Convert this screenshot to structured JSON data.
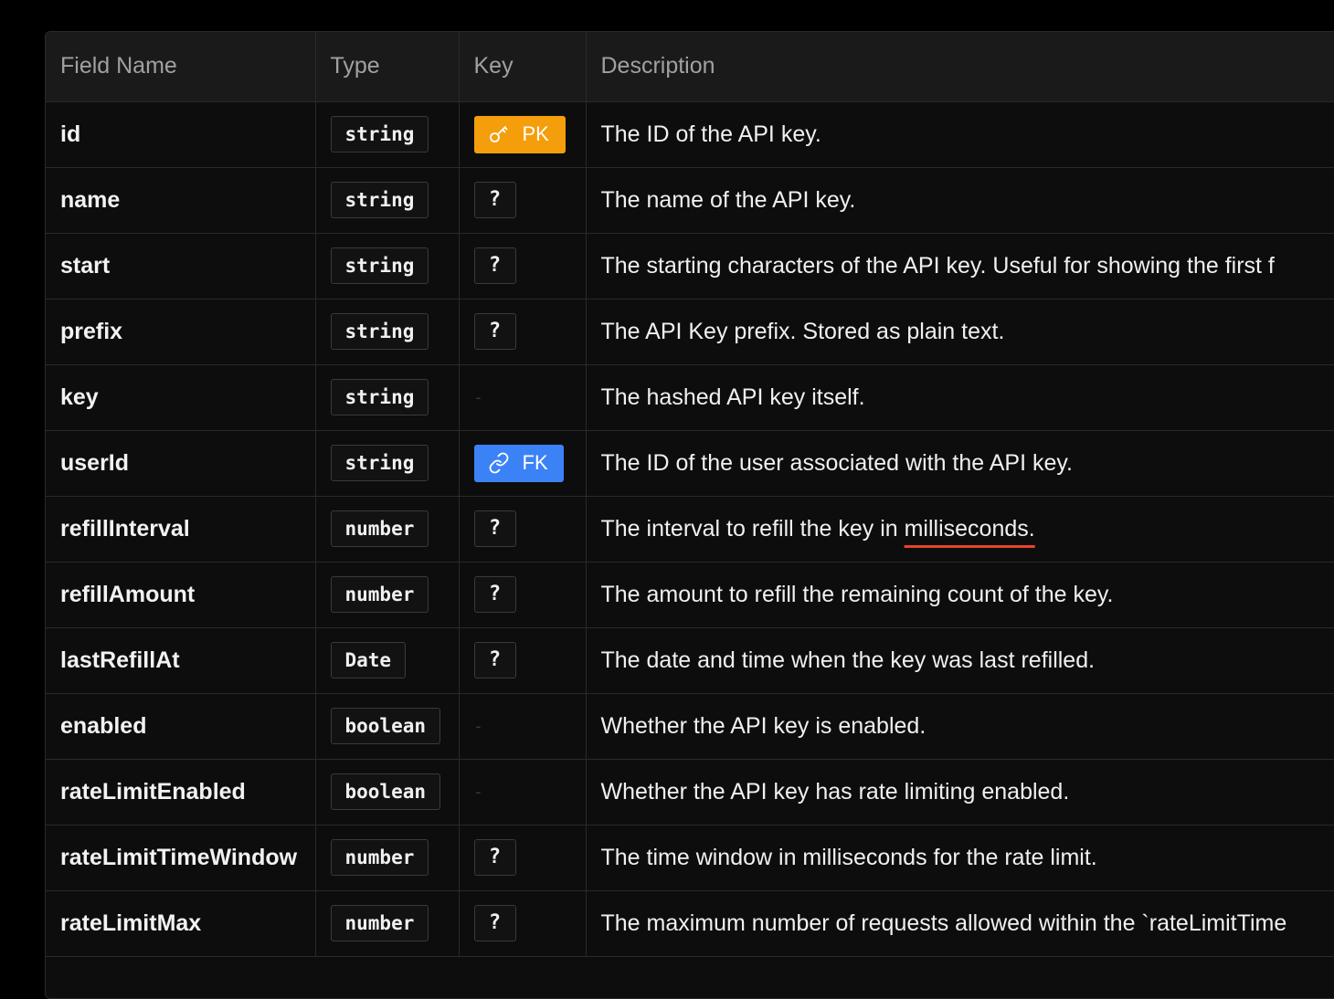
{
  "headers": {
    "field_name": "Field Name",
    "type": "Type",
    "key": "Key",
    "description": "Description"
  },
  "badges": {
    "optional": "?",
    "primary_key": "PK",
    "foreign_key": "FK",
    "none": "-"
  },
  "colors": {
    "pk_badge": "#f59e0b",
    "fk_badge": "#3b82f6",
    "underline": "#e5452a"
  },
  "rows": [
    {
      "name": "id",
      "type": "string",
      "key": "PK",
      "description": "The ID of the API key."
    },
    {
      "name": "name",
      "type": "string",
      "key": "?",
      "description": "The name of the API key."
    },
    {
      "name": "start",
      "type": "string",
      "key": "?",
      "description": "The starting characters of the API key. Useful for showing the first f"
    },
    {
      "name": "prefix",
      "type": "string",
      "key": "?",
      "description": "The API Key prefix. Stored as plain text."
    },
    {
      "name": "key",
      "type": "string",
      "key": "-",
      "description": "The hashed API key itself."
    },
    {
      "name": "userId",
      "type": "string",
      "key": "FK",
      "description": "The ID of the user associated with the API key."
    },
    {
      "name": "refillInterval",
      "type": "number",
      "key": "?",
      "description_prefix": "The interval to refill the key in ",
      "description_underlined": "milliseconds."
    },
    {
      "name": "refillAmount",
      "type": "number",
      "key": "?",
      "description": "The amount to refill the remaining count of the key."
    },
    {
      "name": "lastRefillAt",
      "type": "Date",
      "key": "?",
      "description": "The date and time when the key was last refilled."
    },
    {
      "name": "enabled",
      "type": "boolean",
      "key": "-",
      "description": "Whether the API key is enabled."
    },
    {
      "name": "rateLimitEnabled",
      "type": "boolean",
      "key": "-",
      "description": "Whether the API key has rate limiting enabled."
    },
    {
      "name": "rateLimitTimeWindow",
      "type": "number",
      "key": "?",
      "description": "The time window in milliseconds for the rate limit."
    },
    {
      "name": "rateLimitMax",
      "type": "number",
      "key": "?",
      "description": "The maximum number of requests allowed within the `rateLimitTime"
    }
  ]
}
